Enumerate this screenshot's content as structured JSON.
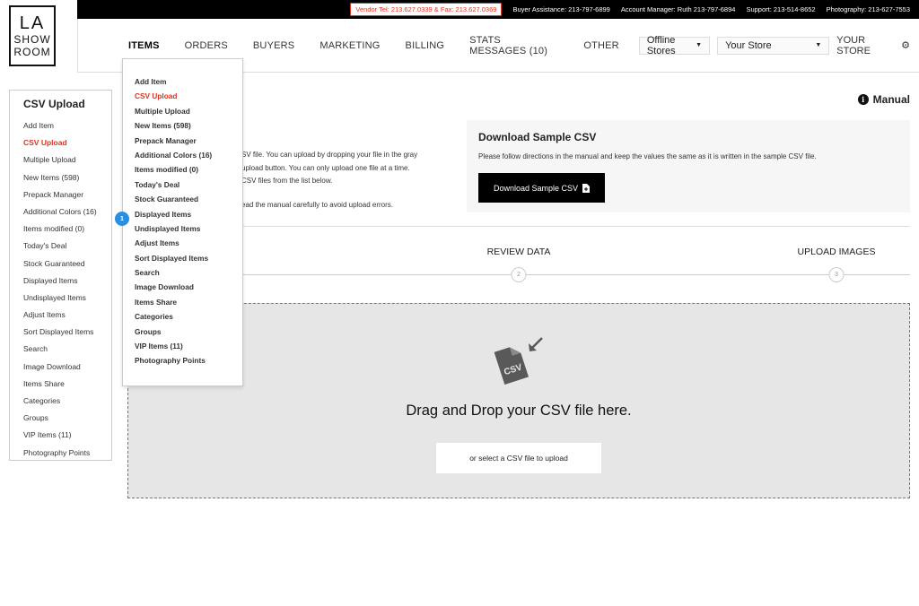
{
  "logo": {
    "line1": "LA",
    "line2": "SHOW",
    "line3": "ROOM"
  },
  "topbar": {
    "vendor_tel": "Vendor Tel: 213.627.0339 & Fax: 213.627.0369",
    "buyer_assistance": "Buyer Assistance: 213-797-6899",
    "account_manager": "Account Manager: Ruth 213-797-6894",
    "support": "Support: 213-514-8652",
    "photography": "Photography: 213-627-7553"
  },
  "nav": {
    "items": [
      "ITEMS",
      "ORDERS",
      "BUYERS",
      "MARKETING",
      "BILLING",
      "STATS MESSAGES (10)",
      "OTHER"
    ],
    "offline_stores": "Offline Stores",
    "your_store_select": "Your Store",
    "your_store": "YOUR STORE"
  },
  "sidebar": {
    "title": "CSV Upload",
    "items": [
      "Add Item",
      "CSV Upload",
      "Multiple Upload",
      "New Items (598)",
      "Prepack Manager",
      "Additional Colors (16)",
      "Items modified (0)",
      "Today's Deal",
      "Stock Guaranteed",
      "Displayed Items",
      "Undisplayed Items",
      "Adjust Items",
      "Sort Displayed Items",
      "Search",
      "Image Download",
      "Items Share",
      "Categories",
      "Groups",
      "VIP Items (11)",
      "Photography Points"
    ]
  },
  "dropdown": {
    "items": [
      "Add Item",
      "CSV Upload",
      "Multiple Upload",
      "New Items (598)",
      "Prepack Manager",
      "Additional Colors (16)",
      "Items modified (0)",
      "Today's Deal",
      "Stock Guaranteed",
      "Displayed Items",
      "Undisplayed Items",
      "Adjust Items",
      "Sort Displayed Items",
      "Search",
      "Image Download",
      "Items Share",
      "Categories",
      "Groups",
      "VIP Items (11)",
      "Photography Points"
    ],
    "badge": "1"
  },
  "main": {
    "manual_label": "Manual",
    "intro_line1": "SV file. You can upload by dropping your file in the gray",
    "intro_line2": "upload button. You can only upload one file at a time.",
    "intro_line3": "CSV files from the list below.",
    "intro_line4": "ead the manual carefully to avoid upload errors.",
    "download": {
      "title": "Download Sample CSV",
      "description": "Please follow directions in the manual and keep the values the same as it is written in the sample CSV file.",
      "button": "Download Sample CSV"
    },
    "steps": [
      {
        "label": "REVIEW DATA",
        "num": "2"
      },
      {
        "label": "UPLOAD IMAGES",
        "num": "3"
      }
    ],
    "dropzone": {
      "icon_text": "CSV",
      "text": "Drag and Drop your CSV file here.",
      "select_button": "or select a CSV file to upload"
    }
  },
  "colors": {
    "accent_red": "#dd3322",
    "badge_blue": "#2b8fe0"
  }
}
